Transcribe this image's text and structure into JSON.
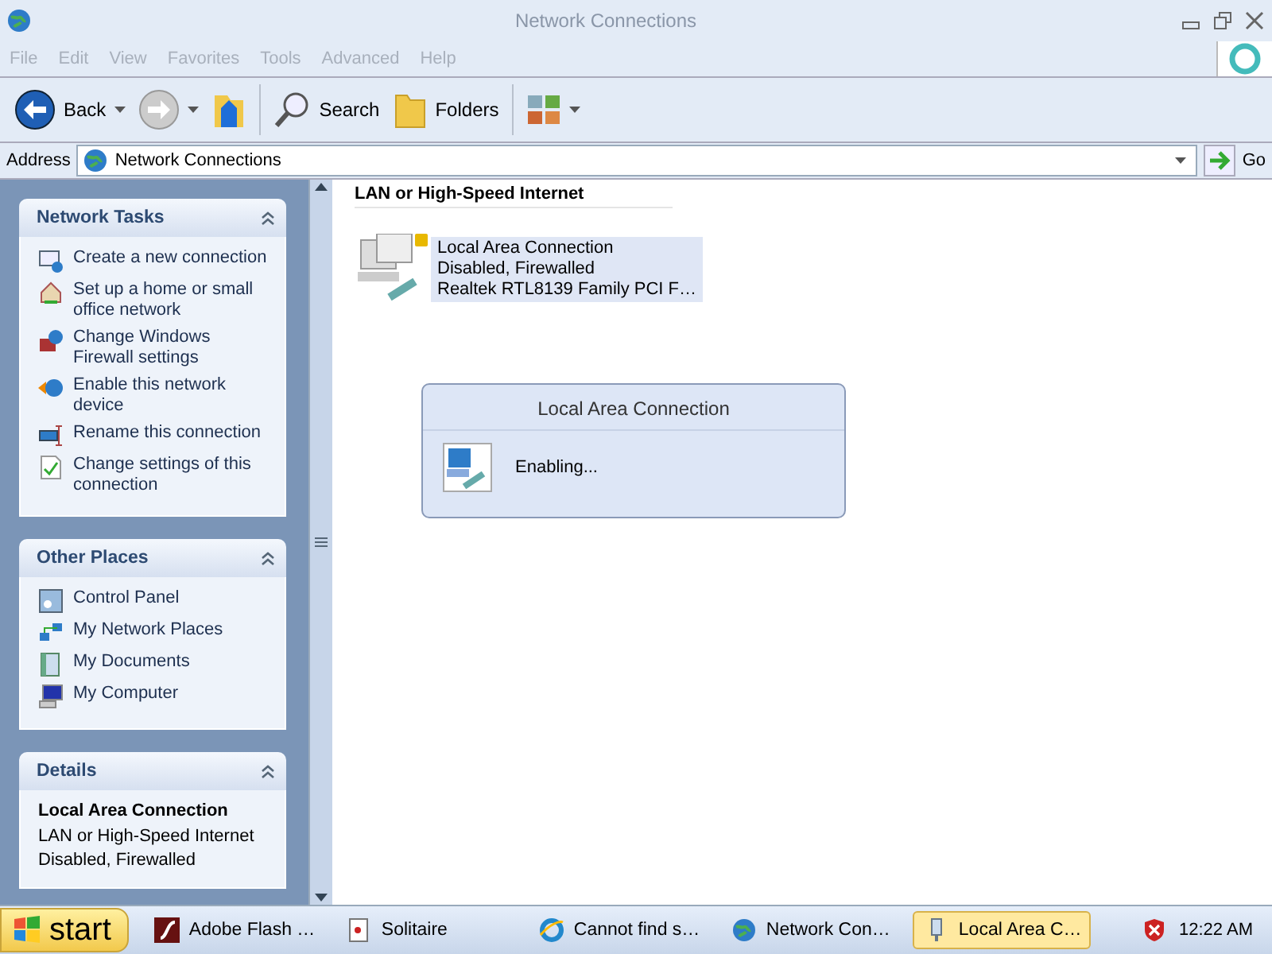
{
  "window": {
    "title": "Network Connections"
  },
  "menu": [
    "File",
    "Edit",
    "View",
    "Favorites",
    "Tools",
    "Advanced",
    "Help"
  ],
  "toolbar": [
    {
      "kind": "back",
      "label": "Back"
    },
    {
      "kind": "forward"
    },
    {
      "kind": "up"
    },
    {
      "kind": "search",
      "label": "Search"
    },
    {
      "kind": "folders",
      "label": "Folders"
    },
    {
      "kind": "views"
    }
  ],
  "address": {
    "label": "Address",
    "value": "Network Connections",
    "go": "Go"
  },
  "sidebar": {
    "panels": [
      {
        "title": "Network Tasks",
        "items": [
          {
            "label": "Create a new connection"
          },
          {
            "label": "Set up a home or small office network"
          },
          {
            "label": "Change Windows Firewall settings"
          },
          {
            "label": "Enable this network device"
          },
          {
            "label": "Rename this connection"
          },
          {
            "label": "Change settings of this connection"
          }
        ]
      },
      {
        "title": "Other Places",
        "items": [
          {
            "label": "Control Panel"
          },
          {
            "label": "My Network Places"
          },
          {
            "label": "My Documents"
          },
          {
            "label": "My Computer"
          }
        ]
      },
      {
        "title": "Details",
        "details": {
          "name": "Local Area Connection",
          "lines": [
            "LAN or High-Speed Internet",
            "Disabled, Firewalled"
          ]
        }
      }
    ]
  },
  "content": {
    "group": "LAN or High-Speed Internet",
    "connections": [
      {
        "name": "Local Area Connection",
        "status": "Disabled, Firewalled",
        "device": "Realtek RTL8139 Family PCI F…",
        "selected": true
      }
    ]
  },
  "dialog": {
    "title": "Local Area Connection",
    "message": "Enabling..."
  },
  "taskbar": {
    "start": "start",
    "tasks": [
      {
        "label": "Adobe Flash …",
        "selected": false
      },
      {
        "label": "Solitaire",
        "selected": false
      },
      {
        "label": "Cannot find s…",
        "selected": false
      },
      {
        "label": "Network Con…",
        "selected": false
      },
      {
        "label": "Local Area C…",
        "selected": true
      }
    ],
    "time": "12:22 AM"
  }
}
